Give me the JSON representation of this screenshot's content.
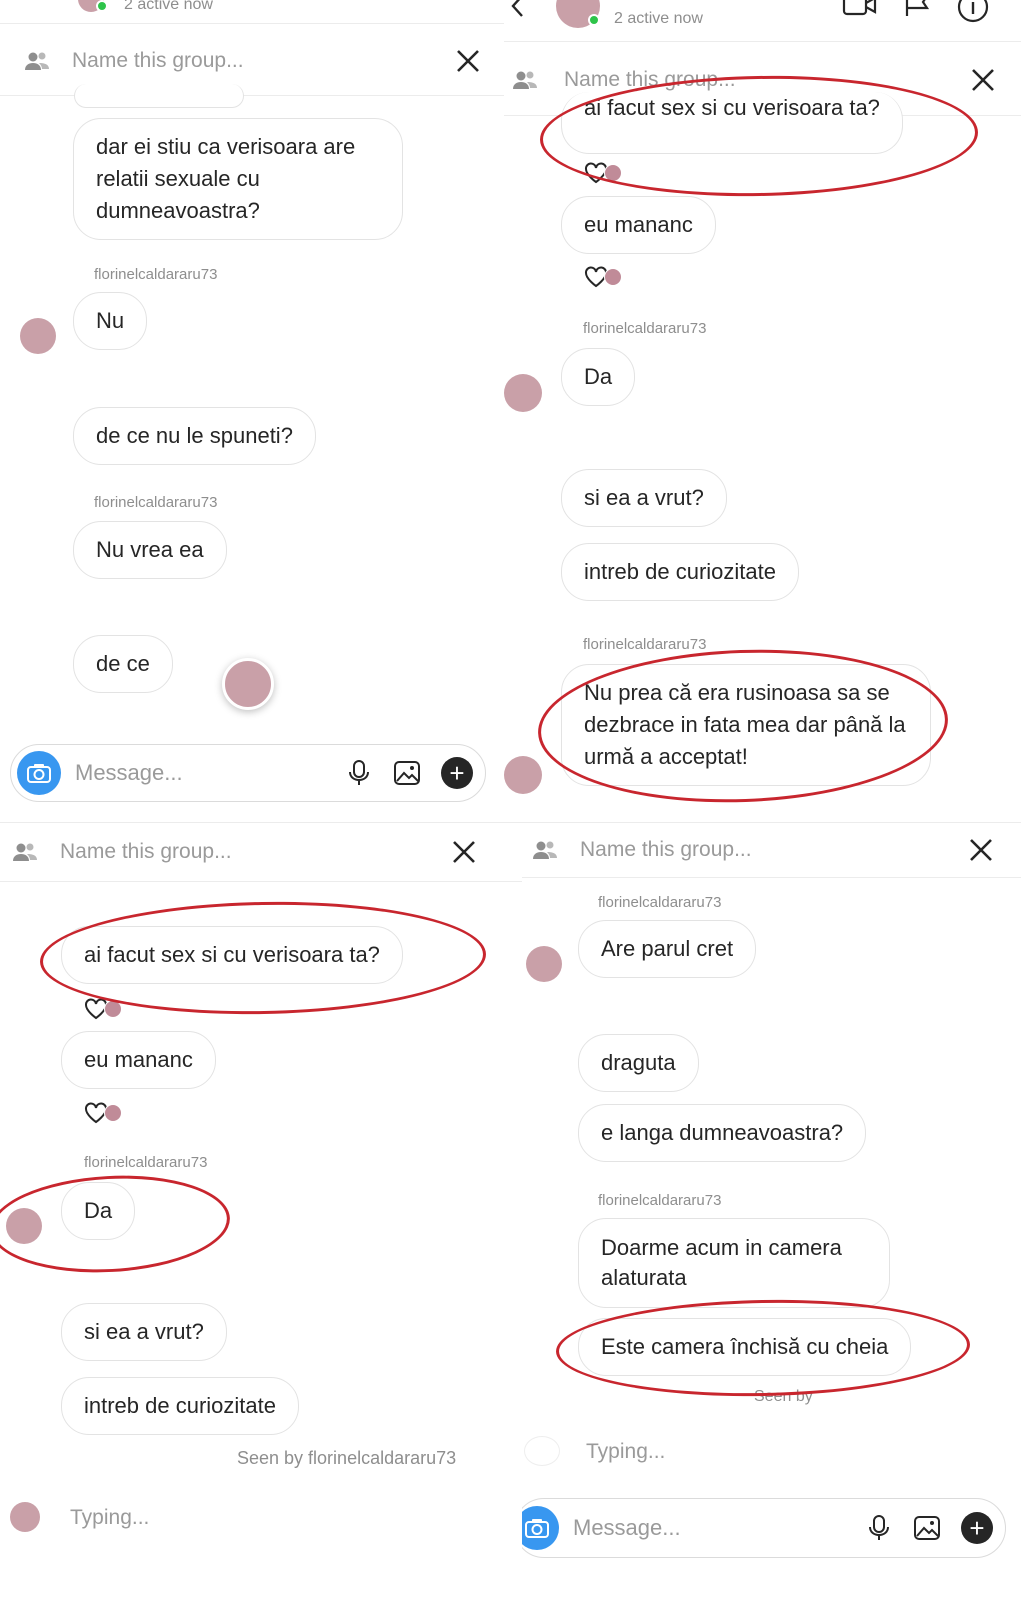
{
  "common": {
    "group_placeholder": "Name this group...",
    "message_placeholder": "Message...",
    "other_user": "florinelcaldararu73",
    "active_status": "2 active now",
    "typing_text": "Typing...",
    "accent_color": "#3897f0",
    "annotation_color": "#c8262e",
    "online_color": "#2ec44a"
  },
  "panel1": {
    "messages": [
      {
        "text": "dar ei stiu ca verisoara are relatii sexuale cu dumneavoastra?"
      },
      {
        "text": "Nu"
      },
      {
        "text": "de ce nu le spuneti?"
      },
      {
        "text": "Nu vrea ea"
      },
      {
        "text": "de ce"
      }
    ]
  },
  "panel2": {
    "messages": [
      {
        "text": "ai facut sex si cu verisoara ta?"
      },
      {
        "text": "eu mananc"
      },
      {
        "text": "Da"
      },
      {
        "text": "si ea a vrut?"
      },
      {
        "text": "intreb de curiozitate"
      },
      {
        "text": "Nu prea că era rusinoasa sa se dezbrace in fata mea dar până la urmă a acceptat!"
      }
    ]
  },
  "panel3": {
    "messages": [
      {
        "text": "ai facut sex si cu verisoara ta?"
      },
      {
        "text": "eu mananc"
      },
      {
        "text": "Da"
      },
      {
        "text": "si ea a vrut?"
      },
      {
        "text": "intreb de curiozitate"
      }
    ],
    "seen_text": "Seen by florinelcaldararu73"
  },
  "panel4": {
    "messages": [
      {
        "text": "Are parul cret"
      },
      {
        "text": "draguta"
      },
      {
        "text": "e langa dumneavoastra?"
      },
      {
        "text": "Doarme acum in camera alaturata"
      },
      {
        "text": "Este camera închisă cu cheia"
      }
    ],
    "seen_text": "Seen by"
  }
}
